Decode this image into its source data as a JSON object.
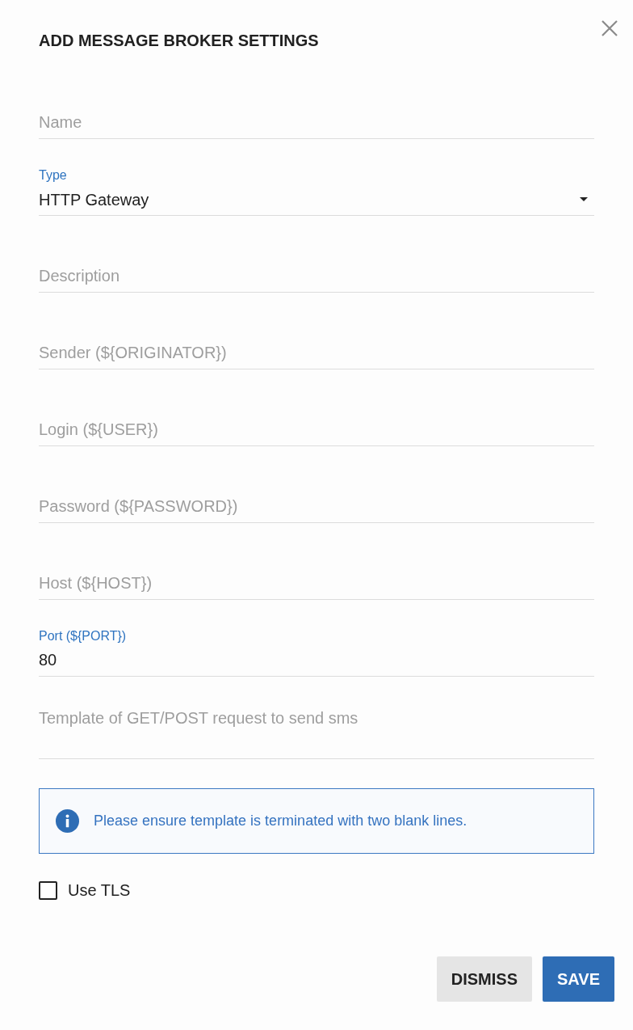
{
  "dialog": {
    "title": "ADD MESSAGE BROKER SETTINGS"
  },
  "fields": [
    {
      "kind": "text",
      "placeholder": "Name"
    },
    {
      "kind": "select",
      "label": "Type",
      "value": "HTTP Gateway"
    },
    {
      "kind": "text",
      "placeholder": "Description"
    },
    {
      "kind": "text",
      "placeholder": "Sender (${ORIGINATOR})"
    },
    {
      "kind": "text",
      "placeholder": "Login (${USER})"
    },
    {
      "kind": "text",
      "placeholder": "Password (${PASSWORD})"
    },
    {
      "kind": "text",
      "placeholder": "Host (${HOST})"
    },
    {
      "kind": "text",
      "label": "Port (${PORT})",
      "value": "80"
    },
    {
      "kind": "textarea",
      "placeholder": "Template of GET/POST request to send sms"
    }
  ],
  "info": {
    "text": "Please ensure template is terminated with two blank lines."
  },
  "checkboxes": [
    {
      "label": "Use TLS",
      "checked": false
    }
  ],
  "buttons": [
    {
      "label": "DISMISS",
      "kind": "secondary"
    },
    {
      "label": "SAVE",
      "kind": "primary"
    }
  ]
}
